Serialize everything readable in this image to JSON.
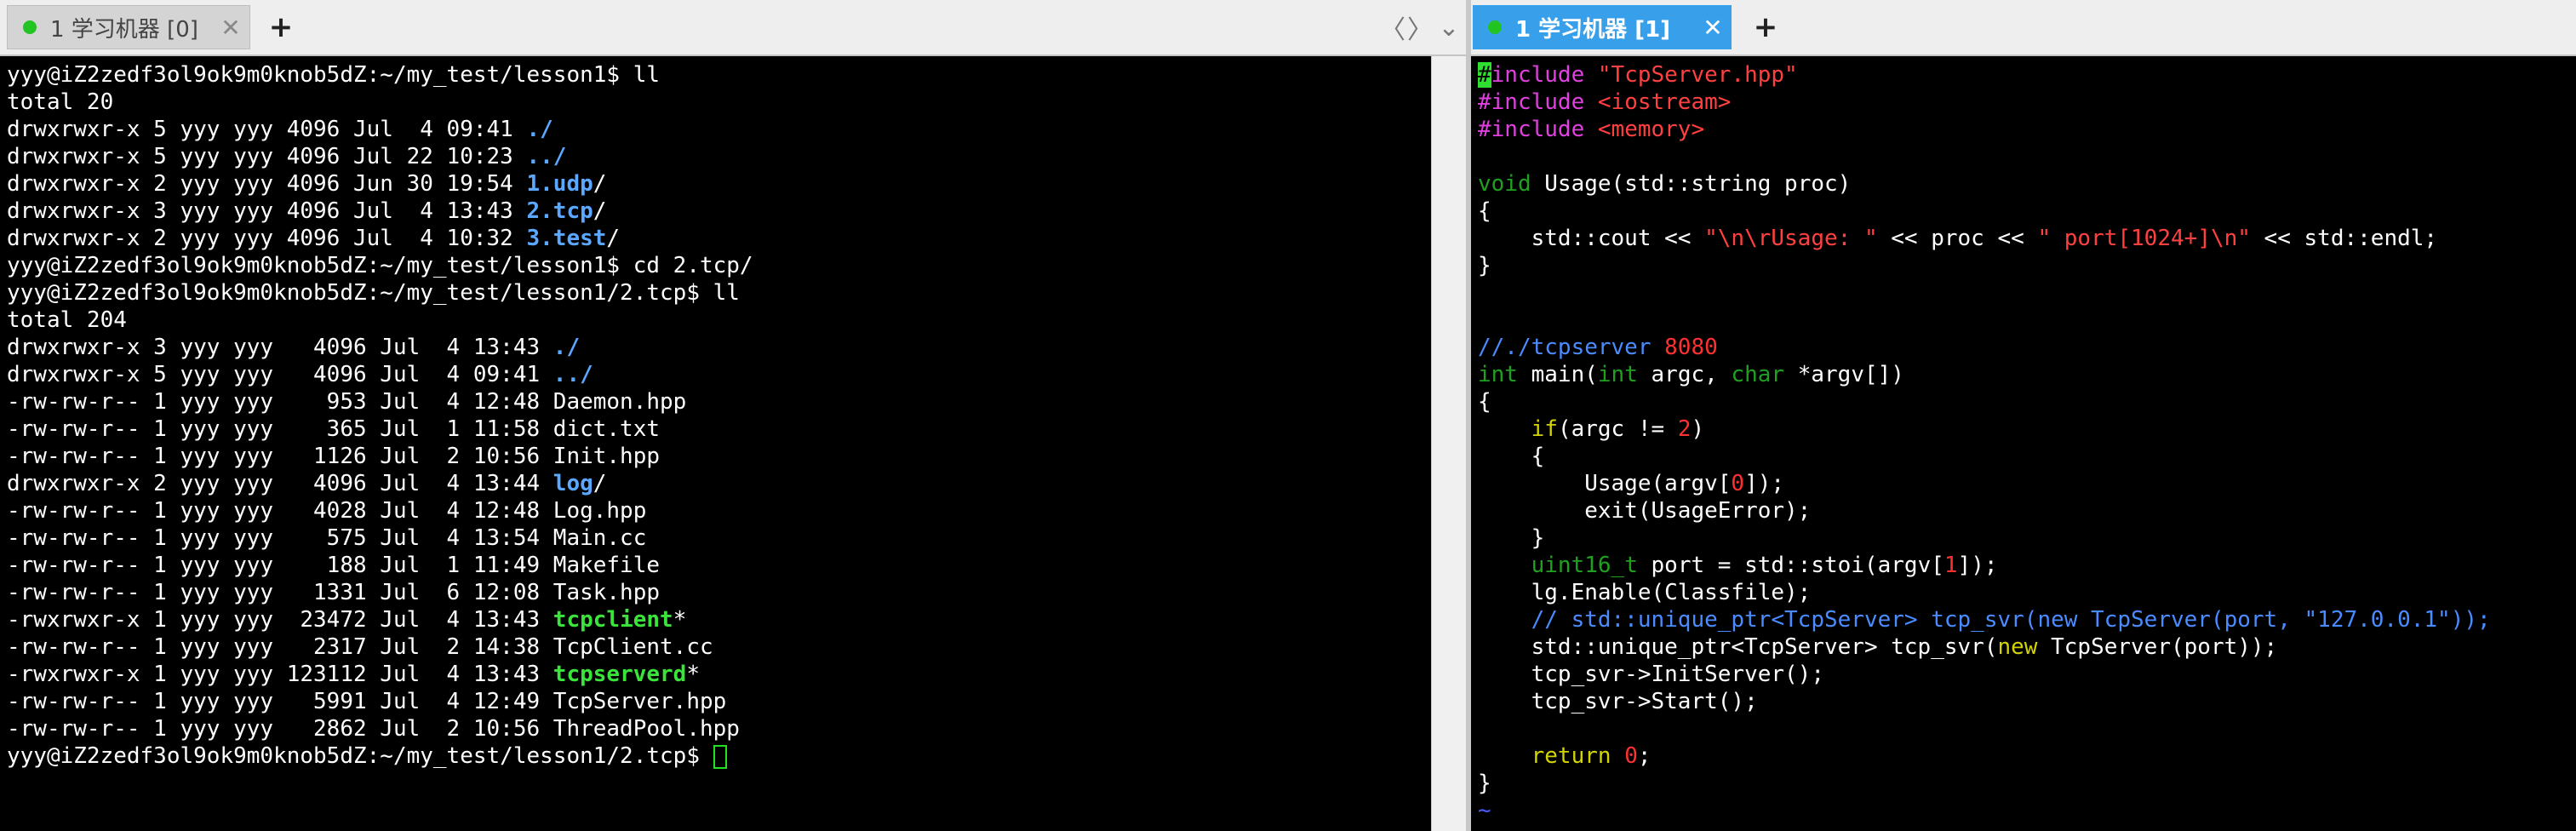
{
  "left_tab": {
    "label": "1 学习机器 [0]",
    "close": "✕"
  },
  "right_tab": {
    "label": "1 学习机器 [1]",
    "close": "✕"
  },
  "plus": "+",
  "nav": {
    "prev": "〈",
    "next": "〉",
    "menu": "⌄"
  },
  "colors": {
    "active_tab": "#38a0ea",
    "status_dot": "#22c322",
    "terminal_bg": "#000000",
    "dir": "#5aa8ff",
    "exe": "#3ae43a"
  },
  "left_lines": [
    [
      {
        "t": "yyy@iZ2zedf3ol9ok9m0knob5dZ:~/my_test/lesson1$ ll"
      }
    ],
    [
      {
        "t": "total 20"
      }
    ],
    [
      {
        "t": "drwxrwxr-x 5 yyy yyy 4096 Jul  4 09:41 "
      },
      {
        "t": "./",
        "c": "c-dir"
      }
    ],
    [
      {
        "t": "drwxrwxr-x 5 yyy yyy 4096 Jul 22 10:23 "
      },
      {
        "t": "../",
        "c": "c-dir"
      }
    ],
    [
      {
        "t": "drwxrwxr-x 2 yyy yyy 4096 Jun 30 19:54 "
      },
      {
        "t": "1.udp",
        "c": "c-dir"
      },
      {
        "t": "/"
      }
    ],
    [
      {
        "t": "drwxrwxr-x 3 yyy yyy 4096 Jul  4 13:43 "
      },
      {
        "t": "2.tcp",
        "c": "c-dir"
      },
      {
        "t": "/"
      }
    ],
    [
      {
        "t": "drwxrwxr-x 2 yyy yyy 4096 Jul  4 10:32 "
      },
      {
        "t": "3.test",
        "c": "c-dir"
      },
      {
        "t": "/"
      }
    ],
    [
      {
        "t": "yyy@iZ2zedf3ol9ok9m0knob5dZ:~/my_test/lesson1$ cd 2.tcp/"
      }
    ],
    [
      {
        "t": "yyy@iZ2zedf3ol9ok9m0knob5dZ:~/my_test/lesson1/2.tcp$ ll"
      }
    ],
    [
      {
        "t": "total 204"
      }
    ],
    [
      {
        "t": "drwxrwxr-x 3 yyy yyy   4096 Jul  4 13:43 "
      },
      {
        "t": "./",
        "c": "c-dir"
      }
    ],
    [
      {
        "t": "drwxrwxr-x 5 yyy yyy   4096 Jul  4 09:41 "
      },
      {
        "t": "../",
        "c": "c-dir"
      }
    ],
    [
      {
        "t": "-rw-rw-r-- 1 yyy yyy    953 Jul  4 12:48 Daemon.hpp"
      }
    ],
    [
      {
        "t": "-rw-rw-r-- 1 yyy yyy    365 Jul  1 11:58 dict.txt"
      }
    ],
    [
      {
        "t": "-rw-rw-r-- 1 yyy yyy   1126 Jul  2 10:56 Init.hpp"
      }
    ],
    [
      {
        "t": "drwxrwxr-x 2 yyy yyy   4096 Jul  4 13:44 "
      },
      {
        "t": "log",
        "c": "c-dir"
      },
      {
        "t": "/"
      }
    ],
    [
      {
        "t": "-rw-rw-r-- 1 yyy yyy   4028 Jul  4 12:48 Log.hpp"
      }
    ],
    [
      {
        "t": "-rw-rw-r-- 1 yyy yyy    575 Jul  4 13:54 Main.cc"
      }
    ],
    [
      {
        "t": "-rw-rw-r-- 1 yyy yyy    188 Jul  1 11:49 Makefile"
      }
    ],
    [
      {
        "t": "-rw-rw-r-- 1 yyy yyy   1331 Jul  6 12:08 Task.hpp"
      }
    ],
    [
      {
        "t": "-rwxrwxr-x 1 yyy yyy  23472 Jul  4 13:43 "
      },
      {
        "t": "tcpclient",
        "c": "c-exe"
      },
      {
        "t": "*"
      }
    ],
    [
      {
        "t": "-rw-rw-r-- 1 yyy yyy   2317 Jul  2 14:38 TcpClient.cc"
      }
    ],
    [
      {
        "t": "-rwxrwxr-x 1 yyy yyy 123112 Jul  4 13:43 "
      },
      {
        "t": "tcpserverd",
        "c": "c-exe"
      },
      {
        "t": "*"
      }
    ],
    [
      {
        "t": "-rw-rw-r-- 1 yyy yyy   5991 Jul  4 12:49 TcpServer.hpp"
      }
    ],
    [
      {
        "t": "-rw-rw-r-- 1 yyy yyy   2862 Jul  2 10:56 ThreadPool.hpp"
      }
    ],
    [
      {
        "t": "yyy@iZ2zedf3ol9ok9m0knob5dZ:~/my_test/lesson1/2.tcp$ "
      },
      {
        "cursor": true
      }
    ]
  ],
  "right_lines": [
    [
      {
        "t": "#",
        "c": "hl"
      },
      {
        "t": "include ",
        "c": "c-pp"
      },
      {
        "t": "\"TcpServer.hpp\"",
        "c": "c-str"
      }
    ],
    [
      {
        "t": "#include ",
        "c": "c-pp"
      },
      {
        "t": "<iostream>",
        "c": "c-str"
      }
    ],
    [
      {
        "t": "#include ",
        "c": "c-pp"
      },
      {
        "t": "<memory>",
        "c": "c-str"
      }
    ],
    [
      {
        "t": ""
      }
    ],
    [
      {
        "t": "void",
        "c": "c-type"
      },
      {
        "t": " Usage(std::string proc)"
      }
    ],
    [
      {
        "t": "{"
      }
    ],
    [
      {
        "t": "    std::cout << "
      },
      {
        "t": "\"\\n\\rUsage: \"",
        "c": "c-str"
      },
      {
        "t": " << proc << "
      },
      {
        "t": "\" port[1024+]\\n\"",
        "c": "c-str"
      },
      {
        "t": " << std::endl;"
      }
    ],
    [
      {
        "t": "}"
      }
    ],
    [
      {
        "t": ""
      }
    ],
    [
      {
        "t": ""
      }
    ],
    [
      {
        "t": "//./tcpserver ",
        "c": "c-cmt"
      },
      {
        "t": "8080",
        "c": "c-num"
      }
    ],
    [
      {
        "t": "int",
        "c": "c-type"
      },
      {
        "t": " main("
      },
      {
        "t": "int",
        "c": "c-type"
      },
      {
        "t": " argc, "
      },
      {
        "t": "char",
        "c": "c-type"
      },
      {
        "t": " *argv[])"
      }
    ],
    [
      {
        "t": "{"
      }
    ],
    [
      {
        "t": "    "
      },
      {
        "t": "if",
        "c": "c-kw"
      },
      {
        "t": "(argc != "
      },
      {
        "t": "2",
        "c": "c-num"
      },
      {
        "t": ")"
      }
    ],
    [
      {
        "t": "    {"
      }
    ],
    [
      {
        "t": "        Usage(argv["
      },
      {
        "t": "0",
        "c": "c-num"
      },
      {
        "t": "]);"
      }
    ],
    [
      {
        "t": "        exit(UsageError);"
      }
    ],
    [
      {
        "t": "    }"
      }
    ],
    [
      {
        "t": "    "
      },
      {
        "t": "uint16_t",
        "c": "c-type"
      },
      {
        "t": " port = std::stoi(argv["
      },
      {
        "t": "1",
        "c": "c-num"
      },
      {
        "t": "]);"
      }
    ],
    [
      {
        "t": "    lg.Enable(Classfile);"
      }
    ],
    [
      {
        "t": "    // std::unique_ptr<TcpServer> tcp_svr(new TcpServer(port, \"127.0.0.1\"));",
        "c": "c-cmt"
      }
    ],
    [
      {
        "t": "    std::unique_ptr<TcpServer> tcp_svr("
      },
      {
        "t": "new",
        "c": "c-kw"
      },
      {
        "t": " TcpServer(port));"
      }
    ],
    [
      {
        "t": "    tcp_svr->InitServer();"
      }
    ],
    [
      {
        "t": "    tcp_svr->Start();"
      }
    ],
    [
      {
        "t": ""
      }
    ],
    [
      {
        "t": "    "
      },
      {
        "t": "return",
        "c": "c-kw"
      },
      {
        "t": " "
      },
      {
        "t": "0",
        "c": "c-num"
      },
      {
        "t": ";"
      }
    ],
    [
      {
        "t": "}"
      }
    ],
    [
      {
        "t": "~",
        "c": "c-tilde"
      }
    ]
  ]
}
